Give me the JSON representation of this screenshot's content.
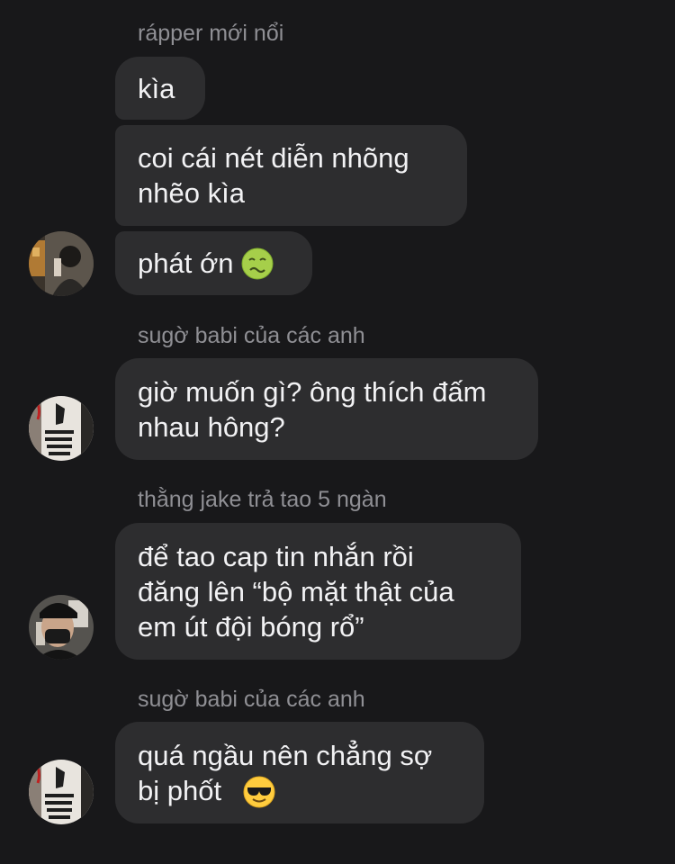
{
  "chat": {
    "groups": [
      {
        "sender": "rápper mới nổi",
        "avatar_icon": "person-photo-avatar-icon",
        "messages": [
          "kìa",
          "coi cái nét diễn nhõng\nnhẽo kìa",
          "phát ớn"
        ],
        "emoji": "nauseated-face-emoji-icon"
      },
      {
        "sender": "sugờ babi của các anh",
        "avatar_icon": "stop-love-graffiti-avatar-icon",
        "messages": [
          "giờ muốn gì? ông thích đấm\nnhau hông?"
        ]
      },
      {
        "sender": "thằng jake trả tao 5 ngàn",
        "avatar_icon": "masked-person-avatar-icon",
        "messages": [
          "để tao cap tin nhắn rồi\nđăng lên “bộ mặt thật của\nem út đội bóng rổ”"
        ]
      },
      {
        "sender": "sugờ babi của các anh",
        "avatar_icon": "stop-love-graffiti-avatar-icon",
        "messages": [
          "quá ngầu nên chẳng sợ\nbị phốt"
        ],
        "emoji": "smiling-face-with-sunglasses-emoji-icon"
      }
    ]
  },
  "colors": {
    "background": "#18181a",
    "bubble": "#2d2d2f",
    "sender_text": "#8f8f94",
    "message_text": "#f2f2f4"
  }
}
